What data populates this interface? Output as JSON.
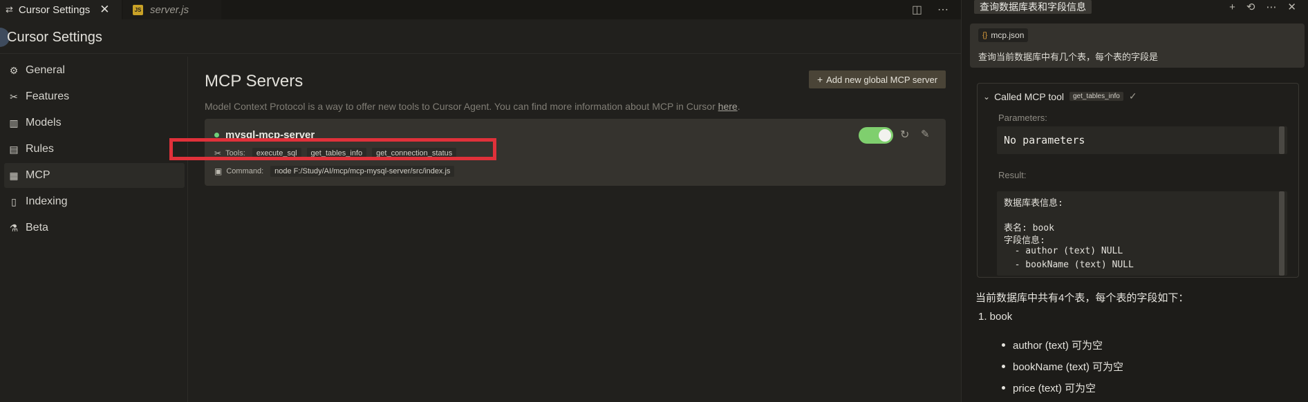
{
  "tabs": [
    {
      "label": "Cursor Settings",
      "icon": "settings-sliders-icon",
      "active": true
    },
    {
      "label": "server.js",
      "icon": "js-file-icon",
      "active": false
    }
  ],
  "tab_icons": {
    "js_badge": "JS",
    "close_glyph": "✕"
  },
  "page_title": "Cursor Settings",
  "sidebar": {
    "items": [
      {
        "label": "General",
        "icon": "gear-icon",
        "glyph": "⚙"
      },
      {
        "label": "Features",
        "icon": "tools-icon",
        "glyph": "✂"
      },
      {
        "label": "Models",
        "icon": "bar-chart-icon",
        "glyph": "▥"
      },
      {
        "label": "Rules",
        "icon": "document-icon",
        "glyph": "▤"
      },
      {
        "label": "MCP",
        "icon": "server-icon",
        "glyph": "▦",
        "active": true
      },
      {
        "label": "Indexing",
        "icon": "database-icon",
        "glyph": "▯"
      },
      {
        "label": "Beta",
        "icon": "flask-icon",
        "glyph": "⚗"
      }
    ]
  },
  "mcp": {
    "title": "MCP Servers",
    "add_button": "Add new global MCP server",
    "description": "Model Context Protocol is a way to offer new tools to Cursor Agent. You can find more information about MCP in Cursor ",
    "description_link": "here",
    "description_end": ".",
    "server": {
      "name": "mysql-mcp-server",
      "status_color": "#6fcf7a",
      "enabled": true,
      "tools_label": "Tools:",
      "tools": [
        "execute_sql",
        "get_tables_info",
        "get_connection_status"
      ],
      "command_label": "Command:",
      "command": "node F:/Study/AI/mcp/mcp-mysql-server/src/index.js"
    }
  },
  "chat": {
    "tab_title": "查询数据库表和字段信息",
    "actions": [
      "plus-icon",
      "history-icon",
      "more-icon",
      "close-icon"
    ],
    "user_message": {
      "file_chip": "mcp.json",
      "text": "查询当前数据库中有几个表，每个表的字段是"
    },
    "tool_call": {
      "label": "Called MCP tool",
      "tool_name": "get_tables_info",
      "parameters_label": "Parameters:",
      "parameters_value": "No parameters",
      "result_label": "Result:",
      "result_lines": [
        "数据库表信息:",
        "",
        "表名: book",
        "字段信息:",
        "  - author (text) NULL",
        "  - bookName (text) NULL"
      ]
    },
    "answer_intro": "当前数据库中共有4个表，每个表的字段如下：",
    "answer_list_item": "1. book",
    "answer_bullets": [
      "author (text) 可为空",
      "bookName (text) 可为空",
      "price (text) 可为空"
    ]
  }
}
